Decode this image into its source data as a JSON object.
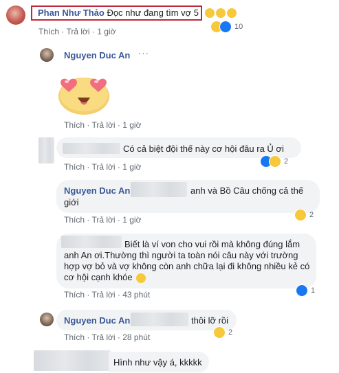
{
  "c1": {
    "name": "Phan Như Thảo",
    "text": "Đọc như đang tìm vợ 5",
    "like": "Thích",
    "reply": "Trả lời",
    "time": "1 giờ",
    "reactions": "10"
  },
  "c2": {
    "name": "Nguyen Duc An",
    "more": "···",
    "like": "Thích",
    "reply": "Trả lời",
    "time": "1 giờ"
  },
  "c3": {
    "text": "Có cả biệt đội thế này cơ hội đâu ra Ủ ơi",
    "like": "Thích",
    "reply": "Trả lời",
    "time": "1 giờ",
    "reactions": "2"
  },
  "c4": {
    "name": "Nguyen Duc An",
    "text1": "anh và Bồ Câu chống cả thế",
    "text2": "giới",
    "like": "Thích",
    "reply": "Trả lời",
    "time": "1 giờ",
    "reactions": "2"
  },
  "c5": {
    "line1": "Biết là ví von cho vui rồi mà không đúng lắm",
    "line2": "anh An ơi.Thường thì người ta toàn nói câu này với trường",
    "line3": "hợp vợ bỏ và vợ không còn anh chữa lại đi không nhiều kẻ có",
    "line4": "cơ hội cạnh khóe",
    "like": "Thích",
    "reply": "Trả lời",
    "time": "43 phút",
    "reactions": "1"
  },
  "c6": {
    "name": "Nguyen Duc An",
    "text": "thôi lỡ rồi",
    "like": "Thích",
    "reply": "Trả lời",
    "time": "28 phút",
    "reactions": "2"
  },
  "c7": {
    "text": "Hình như vậy á, kkkkk"
  },
  "colors": {
    "name": "#385898",
    "highlight_border": "#c0273a",
    "bubble": "#f2f3f5",
    "like_blue": "#1877f2",
    "emoji_yellow": "#f7c83a"
  }
}
